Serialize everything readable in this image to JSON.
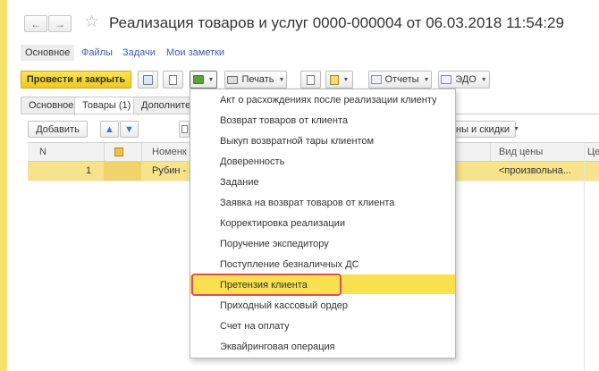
{
  "window": {
    "title": "Реализация товаров и услуг 0000-000004 от 06.03.2018 11:54:29",
    "back_icon": "arrow-left-icon",
    "forward_icon": "arrow-right-icon",
    "favorite_icon": "star-icon"
  },
  "header_tabs": [
    {
      "label": "Основное",
      "active": true
    },
    {
      "label": "Файлы"
    },
    {
      "label": "Задачи"
    },
    {
      "label": "Мои заметки"
    }
  ],
  "toolbar": {
    "post_close_label": "Провести и закрыть",
    "print_label": "Печать",
    "reports_label": "Отчеты",
    "edo_label": "ЭДО"
  },
  "content_tabs": [
    {
      "label": "Основное"
    },
    {
      "label": "Товары (1)",
      "active": true
    },
    {
      "label": "Дополнитель"
    }
  ],
  "goods_toolbar": {
    "add_label": "Добавить",
    "prices_discounts_label": "ны и скидки"
  },
  "grid": {
    "columns": [
      "N",
      "Номенк",
      "Вид цены",
      "Це"
    ],
    "rows": [
      {
        "n": "1",
        "item": "Рубин - З",
        "price_type": "<произвольна..."
      }
    ]
  },
  "create_based_on_menu": {
    "items": [
      "Акт о расхождениях после реализации клиенту",
      "Возврат товаров от клиента",
      "Выкуп возвратной тары клиентом",
      "Доверенность",
      "Задание",
      "Заявка на возврат товаров от клиента",
      "Корректировка реализации",
      "Поручение экспедитору",
      "Поступление безналичных ДС",
      "Претензия клиента",
      "Приходный кассовый ордер",
      "Счет на оплату",
      "Эквайринговая операция"
    ],
    "highlighted_index": 9
  },
  "colors": {
    "accent_yellow": "#f2c81a",
    "selected_row": "#f8e28c",
    "highlight": "#f9e04e",
    "outline_red": "#d9534f",
    "link_blue": "#3a5fa8"
  }
}
